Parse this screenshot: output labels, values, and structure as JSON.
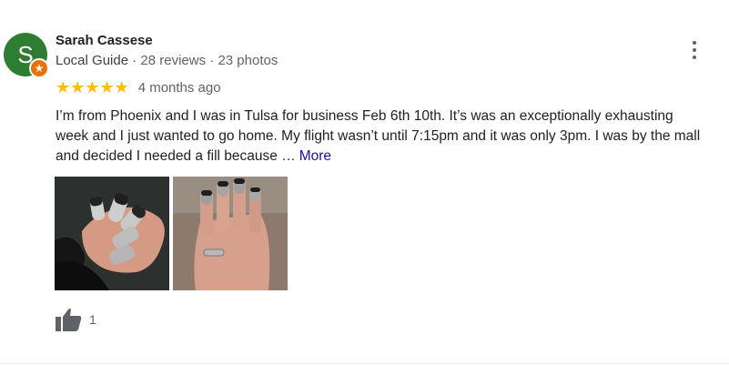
{
  "reviewer": {
    "initial": "S",
    "name": "Sarah Cassese",
    "guide_label": "Local Guide",
    "separator": "·",
    "reviews": "28 reviews",
    "photos": "23 photos",
    "avatar_color": "#2f7d32",
    "badge_color": "#e8710a"
  },
  "rating": {
    "stars": 5,
    "stars_text": "★★★★★",
    "star_color": "#fbbc04",
    "time_ago": "4 months ago"
  },
  "review": {
    "line1": "I’m from Phoenix and I was in Tulsa for business Feb 6th 10th. It’s was an exceptionally exhausting",
    "line2": "week and I just wanted to go home. My flight wasn’t until 7:15pm and it was only 3pm. I was by the mall",
    "line3": "and decided I needed a fill because …",
    "more_label": "More"
  },
  "photos": [
    {
      "icon": "nail-photo"
    },
    {
      "icon": "nail-photo"
    }
  ],
  "actions": {
    "like_icon": "thumbs-up-icon",
    "like_count": "1",
    "menu_icon": "more-vert-icon"
  }
}
